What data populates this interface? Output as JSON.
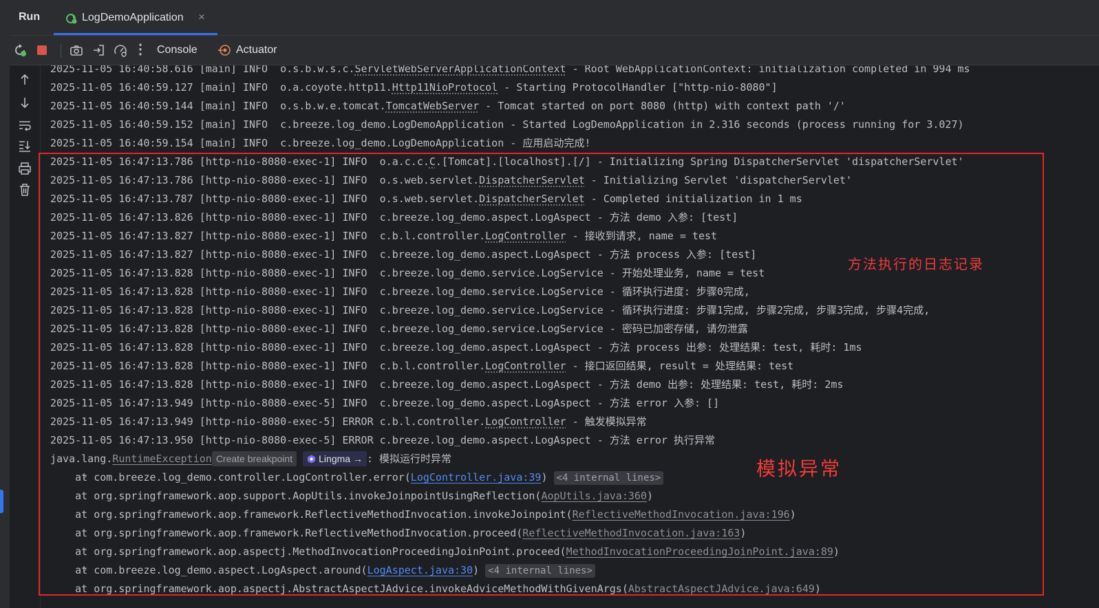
{
  "window": {
    "run_title": "Run"
  },
  "run_tab": {
    "label": "LogDemoApplication",
    "close": "×"
  },
  "toolbar": {
    "tabs": [
      {
        "label": "Console"
      },
      {
        "label": "Actuator"
      }
    ],
    "more": "⋮"
  },
  "colors": {
    "accent": "#3574f0",
    "annotation": "#f03a3a",
    "link": "#548af7",
    "stop": "#d9534f",
    "rerun": "#5fb865"
  },
  "icons": [
    "rerun-icon",
    "stop-icon",
    "camera-icon",
    "exit-icon",
    "gauge-icon",
    "more-icon",
    "actuator-icon",
    "arrow-up-icon",
    "arrow-down-icon",
    "soft-wrap-icon",
    "scroll-to-end-icon",
    "print-icon",
    "trash-icon",
    "chevron-right-icon",
    "lingma-icon"
  ],
  "log": {
    "l1": {
      "prefix": "2025-11-05 16:40:58.616 [main] INFO  o.s.b.w.s.c.",
      "cls": "ServletWebServerApplicationContext",
      "rest": " - Root WebApplicationContext: initialization completed in 994 ms"
    },
    "l2": {
      "prefix": "2025-11-05 16:40:59.127 [main] INFO  o.a.coyote.http11.",
      "cls": "Http11NioProtocol",
      "rest": " - Starting ProtocolHandler [\"http-nio-8080\"]"
    },
    "l3": {
      "prefix": "2025-11-05 16:40:59.144 [main] INFO  o.s.b.w.e.tomcat.",
      "cls": "TomcatWebServer",
      "rest": " - Tomcat started on port 8080 (http) with context path '/'"
    },
    "l4": {
      "text": "2025-11-05 16:40:59.152 [main] INFO  c.breeze.log_demo.LogDemoApplication - Started LogDemoApplication in 2.316 seconds (process running for 3.027)"
    },
    "l5": {
      "text": "2025-11-05 16:40:59.154 [main] INFO  c.breeze.log_demo.LogDemoApplication - 应用启动完成!"
    },
    "l6": {
      "prefix": "2025-11-05 16:47:13.786 [http-nio-8080-exec-1] INFO  o.a.c.c.",
      "cls": "C",
      "rest": ".[Tomcat].[localhost].[/] - Initializing Spring DispatcherServlet 'dispatcherServlet'"
    },
    "l7": {
      "prefix": "2025-11-05 16:47:13.786 [http-nio-8080-exec-1] INFO  o.s.web.servlet.",
      "cls": "DispatcherServlet",
      "rest": " - Initializing Servlet 'dispatcherServlet'"
    },
    "l8": {
      "prefix": "2025-11-05 16:47:13.787 [http-nio-8080-exec-1] INFO  o.s.web.servlet.",
      "cls": "DispatcherServlet",
      "rest": " - Completed initialization in 1 ms"
    },
    "l9": {
      "text": "2025-11-05 16:47:13.826 [http-nio-8080-exec-1] INFO  c.breeze.log_demo.aspect.LogAspect - 方法 demo 入参: [test]"
    },
    "l10": {
      "prefix": "2025-11-05 16:47:13.827 [http-nio-8080-exec-1] INFO  c.b.l.controller.",
      "cls": "LogController",
      "rest": " - 接收到请求, name = test"
    },
    "l11": {
      "text": "2025-11-05 16:47:13.827 [http-nio-8080-exec-1] INFO  c.breeze.log_demo.aspect.LogAspect - 方法 process 入参: [test]"
    },
    "l12": {
      "text": "2025-11-05 16:47:13.828 [http-nio-8080-exec-1] INFO  c.breeze.log_demo.service.LogService - 开始处理业务, name = test"
    },
    "l13": {
      "text": "2025-11-05 16:47:13.828 [http-nio-8080-exec-1] INFO  c.breeze.log_demo.service.LogService - 循环执行进度: 步骤0完成,"
    },
    "l14": {
      "text": "2025-11-05 16:47:13.828 [http-nio-8080-exec-1] INFO  c.breeze.log_demo.service.LogService - 循环执行进度: 步骤1完成, 步骤2完成, 步骤3完成, 步骤4完成,"
    },
    "l15": {
      "text": "2025-11-05 16:47:13.828 [http-nio-8080-exec-1] INFO  c.breeze.log_demo.service.LogService - 密码已加密存储, 请勿泄露"
    },
    "l16": {
      "text": "2025-11-05 16:47:13.828 [http-nio-8080-exec-1] INFO  c.breeze.log_demo.aspect.LogAspect - 方法 process 出参: 处理结果: test, 耗时: 1ms"
    },
    "l17": {
      "prefix": "2025-11-05 16:47:13.828 [http-nio-8080-exec-1] INFO  c.b.l.controller.",
      "cls": "LogController",
      "rest": " - 接口返回结果, result = 处理结果: test"
    },
    "l18": {
      "text": "2025-11-05 16:47:13.828 [http-nio-8080-exec-1] INFO  c.breeze.log_demo.aspect.LogAspect - 方法 demo 出参: 处理结果: test, 耗时: 2ms"
    },
    "l19": {
      "text": "2025-11-05 16:47:13.949 [http-nio-8080-exec-5] INFO  c.breeze.log_demo.aspect.LogAspect - 方法 error 入参: []"
    },
    "l20": {
      "prefix": "2025-11-05 16:47:13.949 [http-nio-8080-exec-5] ERROR c.b.l.controller.",
      "cls": "LogController",
      "rest": " - 触发模拟异常"
    },
    "l21": {
      "text": "2025-11-05 16:47:13.950 [http-nio-8080-exec-5] ERROR c.breeze.log_demo.aspect.LogAspect - 方法 error 执行异常"
    },
    "ex": {
      "prefix": "java.lang.",
      "cls": "RuntimeException",
      "create_bp": "Create breakpoint",
      "lingma": "Lingma →",
      "msg": ": 模拟运行时异常"
    },
    "st1": {
      "pre": "    at com.breeze.log_demo.controller.LogController.error(",
      "link": "LogController.java:39",
      "post": ")",
      "internal": "<4 internal lines>"
    },
    "st2": {
      "pre": "    at org.springframework.aop.support.AopUtils.invokeJoinpointUsingReflection(",
      "link": "AopUtils.java:360",
      "post": ")"
    },
    "st3": {
      "pre": "    at org.springframework.aop.framework.ReflectiveMethodInvocation.invokeJoinpoint(",
      "link": "ReflectiveMethodInvocation.java:196",
      "post": ")"
    },
    "st4": {
      "pre": "    at org.springframework.aop.framework.ReflectiveMethodInvocation.proceed(",
      "link": "ReflectiveMethodInvocation.java:163",
      "post": ")"
    },
    "st5": {
      "pre": "    at org.springframework.aop.aspectj.MethodInvocationProceedingJoinPoint.proceed(",
      "link": "MethodInvocationProceedingJoinPoint.java:89",
      "post": ")"
    },
    "st6": {
      "pre": "    at com.breeze.log_demo.aspect.LogAspect.around(",
      "link": "LogAspect.java:30",
      "post": ")",
      "internal": "<4 internal lines>"
    },
    "st7": {
      "pre": "    at org.springframework.aop.aspectj.AbstractAspectJAdvice.invokeAdviceMethodWithGivenArgs(",
      "link": "AbstractAspectJAdvice.java:649",
      "post": ")"
    },
    "chevron": "›"
  },
  "annotations": {
    "method_log": "方法执行的日志记录",
    "exception": "模拟异常"
  }
}
